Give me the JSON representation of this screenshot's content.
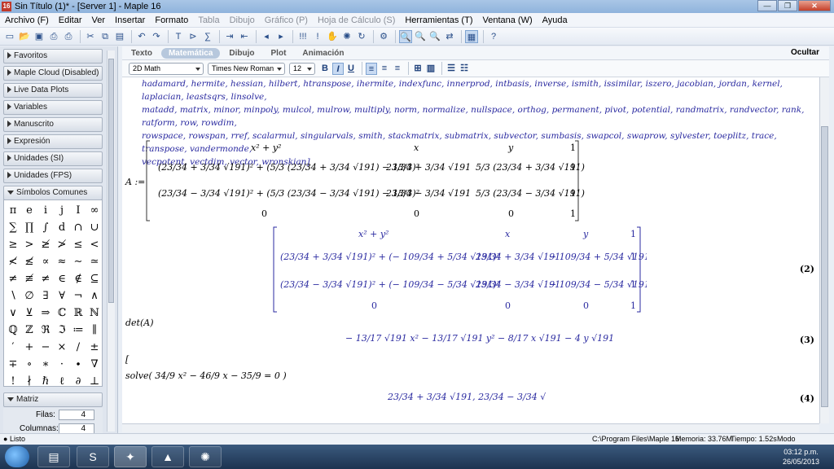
{
  "window": {
    "title": "Sin Título (1)* - [Server 1] - Maple 16",
    "app_icon": "16"
  },
  "menu": [
    "Archivo (F)",
    "Editar",
    "Ver",
    "Insertar",
    "Formato",
    "Tabla",
    "Dibujo",
    "Gráfico (P)",
    "Hoja de Cálculo (S)",
    "Herramientas (T)",
    "Ventana (W)",
    "Ayuda"
  ],
  "palettes": [
    "Favoritos",
    "Maple Cloud (Disabled)",
    "Live Data Plots",
    "Variables",
    "Manuscrito",
    "Expresión",
    "Unidades (SI)",
    "Unidades (FPS)",
    "Símbolos Comunes"
  ],
  "symbols": [
    "π",
    "e",
    "i",
    "j",
    "I",
    "∞",
    "∑",
    "∏",
    "∫",
    "d",
    "∩",
    "∪",
    "≥",
    ">",
    "≱",
    "≯",
    "≤",
    "<",
    "≮",
    "≰",
    "∝",
    "≈",
    "∼",
    "≃",
    "≠",
    "≢",
    "≠",
    "∈",
    "∉",
    "⊆",
    "∖",
    "∅",
    "∃",
    "∀",
    "¬",
    "∧",
    "∨",
    "⊻",
    "⇒",
    "ℂ",
    "ℝ",
    "ℕ",
    "ℚ",
    "ℤ",
    "ℜ",
    "ℑ",
    "≔",
    "∥",
    "′",
    "+",
    "−",
    "×",
    "/",
    "±",
    "∓",
    "∘",
    "∗",
    "·",
    "∙",
    "∇",
    "!",
    "∤",
    "ℏ",
    "ℓ",
    "∂",
    "⊥"
  ],
  "matriz": {
    "header": "Matriz",
    "filas_label": "Filas:",
    "filas_value": "4",
    "columnas_label": "Columnas:",
    "columnas_value": "4"
  },
  "mode_tabs": [
    "Texto",
    "Matemática",
    "Dibujo",
    "Plot",
    "Animación"
  ],
  "hide_label": "Ocultar",
  "format": {
    "style": "2D Math",
    "font": "Times New Roman",
    "size": "12"
  },
  "doc": {
    "func_list_1": "hadamard, hermite, hessian, hilbert, htranspose, ihermite, indexfunc, innerprod, intbasis, inverse, ismith, issimilar, iszero, jacobian, jordan, kernel, laplacian, leastsqrs, linsolve,",
    "func_list_2": "matadd, matrix, minor, minpoly, mulcol, mulrow, multiply, norm, normalize, nullspace, orthog, permanent, pivot, potential, randmatrix, randvector, rank, ratform, row, rowdim,",
    "func_list_3": "rowspace, rowspan, rref, scalarmul, singularvals, smith, stackmatrix, submatrix, subvector, sumbasis, swapcol, swaprow, sylvester, toeplitz, trace, transpose, vandermonde,",
    "func_list_4": "vecpotent, vectdim, vector, wronskian]",
    "assign_A": "A :=",
    "det_input": "det(A)",
    "det_output": "− 13/17 √191 x² − 13/17 √191 y² − 8/17 x √191 − 4 y √191",
    "solve_input": "solve( 34/9 x² − 46/9 x − 35/9 = 0 )",
    "eq2": "(2)",
    "eq3": "(3)",
    "eq4": "(4)"
  },
  "status": {
    "left": "Listo",
    "path": "C:\\Program Files\\Maple 16",
    "mem": "Memoria: 33.76M",
    "time": "Tiempo: 1.52s",
    "mode": "Modo Matemático"
  },
  "clock": {
    "time": "03:12 p.m.",
    "date": "26/05/2013"
  }
}
